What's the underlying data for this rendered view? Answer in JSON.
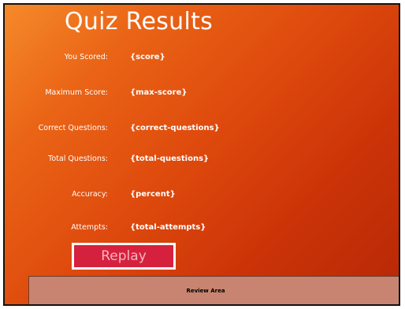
{
  "title": "Quiz Results",
  "rows": [
    {
      "label": "You Scored:",
      "value": "{score}"
    },
    {
      "label": "Maximum Score:",
      "value": "{max-score}"
    },
    {
      "label": "Correct Questions:",
      "value": "{correct-questions}"
    },
    {
      "label": "Total Questions:",
      "value": "{total-questions}"
    },
    {
      "label": "Accuracy:",
      "value": "{percent}"
    },
    {
      "label": "Attempts:",
      "value": "{total-attempts}"
    }
  ],
  "replay_label": "Replay",
  "review_area_label": "Review Area",
  "colors": {
    "background_start": "#f58a2a",
    "background_end": "#b62806",
    "replay_button": "#d6213e",
    "review_area": "#c88470"
  }
}
